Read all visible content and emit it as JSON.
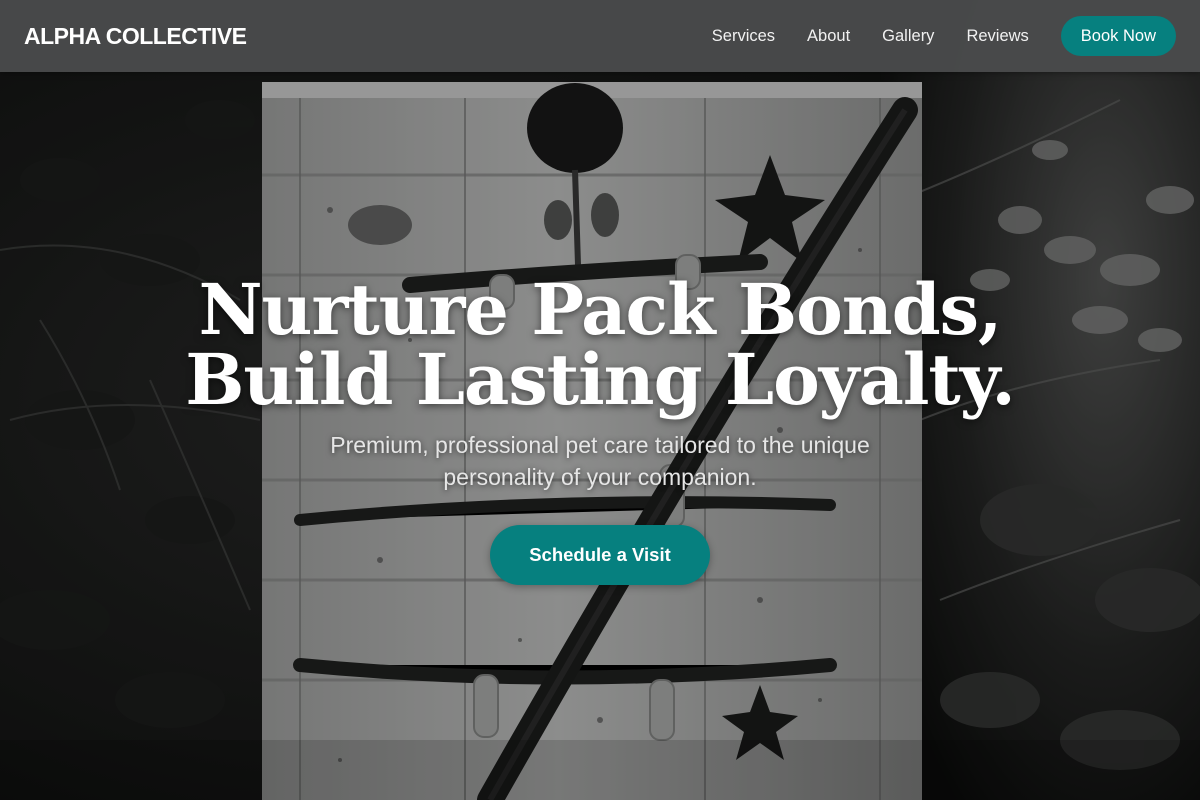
{
  "nav": {
    "brand": "ALPHA COLLECTIVE",
    "links": [
      "Services",
      "About",
      "Gallery",
      "Reviews"
    ],
    "cta_label": "Book Now"
  },
  "hero": {
    "title_line_1": "Nurture Pack Bonds,",
    "title_line_2": "Build Lasting Loyalty.",
    "subtitle_line_1": "Premium, professional pet care tailored to the unique",
    "subtitle_line_2": "personality of your companion.",
    "cta_label": "Schedule a Visit",
    "background_image": "black-and-white-painted-wooden-box-with-sticks"
  },
  "colors": {
    "accent": "#06807f",
    "navbar": "#4a4b4c",
    "text": "#ffffff"
  }
}
